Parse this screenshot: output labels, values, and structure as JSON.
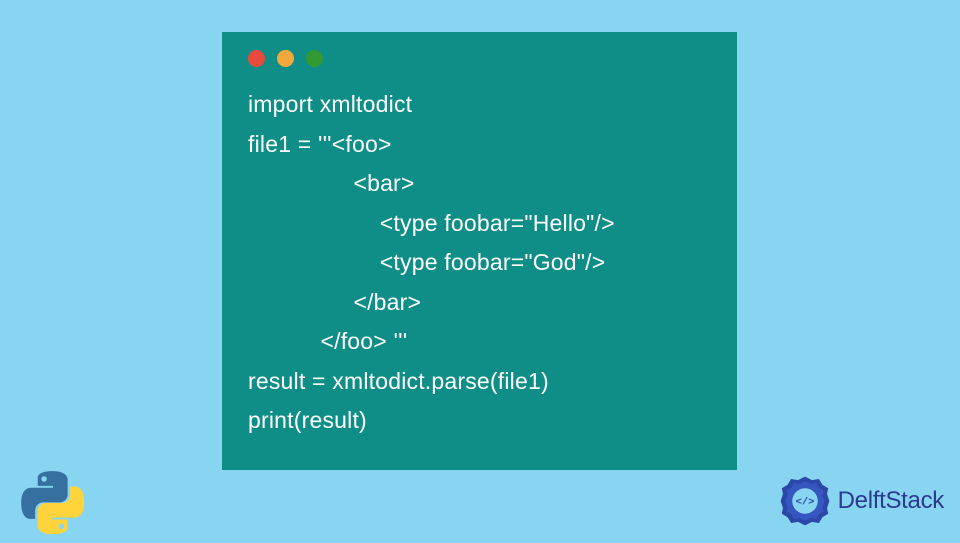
{
  "code": {
    "line1": "import xmltodict",
    "line2": "file1 = '''<foo>",
    "line3": "                <bar>",
    "line4": "                    <type foobar=\"Hello\"/>",
    "line5": "                    <type foobar=\"God\"/>",
    "line6": "                </bar>",
    "line7": "           </foo> '''",
    "line8": "result = xmltodict.parse(file1)",
    "line9": "print(result)"
  },
  "brand": {
    "name": "DelftStack"
  },
  "window": {
    "dots": [
      "red",
      "yellow",
      "green"
    ]
  }
}
